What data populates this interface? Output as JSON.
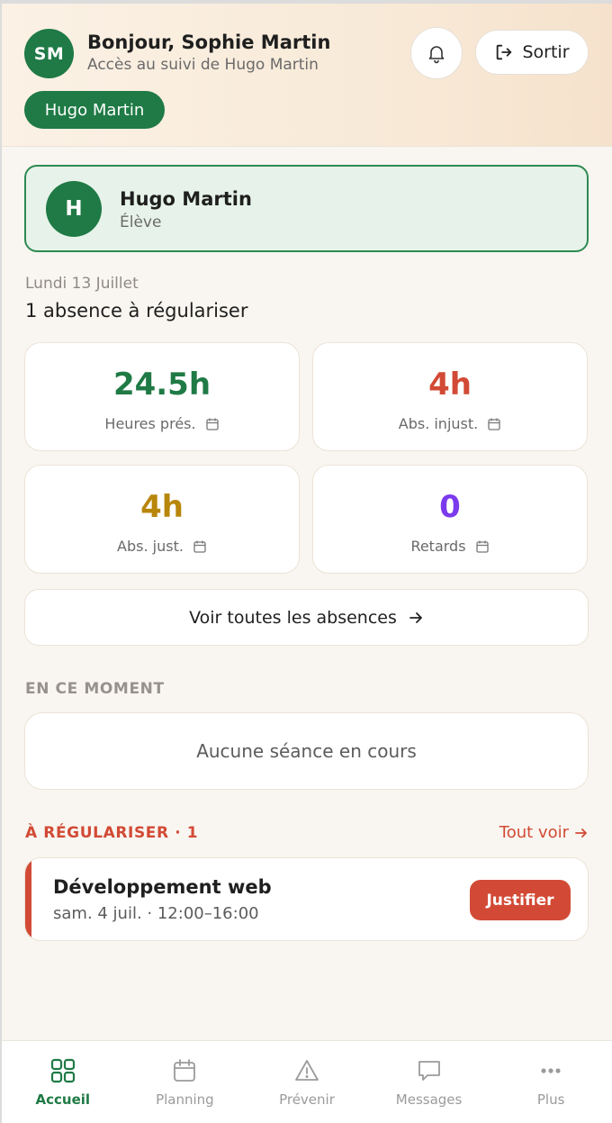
{
  "header": {
    "avatar_initials": "SM",
    "greeting": "Bonjour, Sophie Martin",
    "subtitle": "Accès au suivi de Hugo Martin",
    "logout_label": "Sortir",
    "child_chip": "Hugo Martin"
  },
  "student": {
    "initial": "H",
    "name": "Hugo Martin",
    "role": "Élève"
  },
  "summary": {
    "date": "Lundi 13 Juillet",
    "text": "1 absence à régulariser"
  },
  "stats": [
    {
      "value": "24.5h",
      "label": "Heures prés.",
      "color": "#1f7a45"
    },
    {
      "value": "4h",
      "label": "Abs. injust.",
      "color": "#d24a35"
    },
    {
      "value": "4h",
      "label": "Abs. just.",
      "color": "#b8860b"
    },
    {
      "value": "0",
      "label": "Retards",
      "color": "#7c3aed"
    }
  ],
  "all_absences_label": "Voir toutes les absences",
  "now": {
    "title": "EN CE MOMENT",
    "empty": "Aucune séance en cours"
  },
  "regularize": {
    "title": "À RÉGULARISER · 1",
    "see_all": "Tout voir",
    "items": [
      {
        "course": "Développement web",
        "when": "sam. 4 juil. · 12:00–16:00",
        "action": "Justifier"
      }
    ]
  },
  "nav": [
    {
      "label": "Accueil",
      "icon": "grid-icon",
      "active": true
    },
    {
      "label": "Planning",
      "icon": "calendar-icon",
      "active": false
    },
    {
      "label": "Prévenir",
      "icon": "warning-icon",
      "active": false
    },
    {
      "label": "Messages",
      "icon": "message-icon",
      "active": false
    },
    {
      "label": "Plus",
      "icon": "more-icon",
      "active": false
    }
  ],
  "colors": {
    "brand": "#1f7a45",
    "alert": "#d24a35"
  }
}
